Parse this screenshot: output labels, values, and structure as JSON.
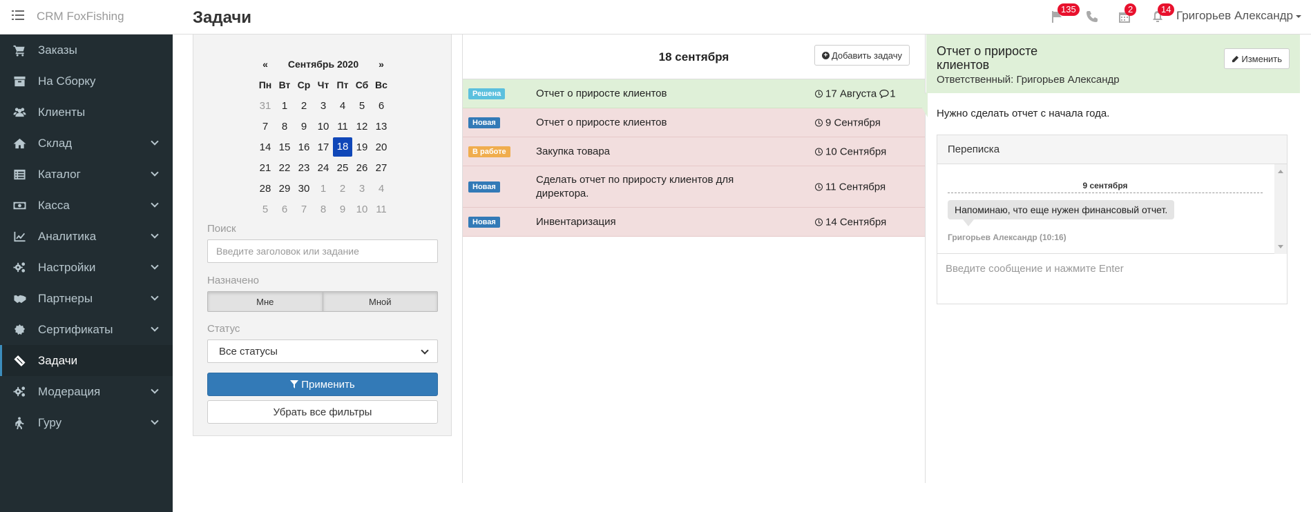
{
  "header": {
    "brand": "CRM FoxFishing",
    "page_title": "Задачи",
    "badges": {
      "flag": "135",
      "calendar": "2",
      "bell": "14"
    },
    "user_name": "Григорьев Александр"
  },
  "sidebar": {
    "items": [
      {
        "label": "Заказы",
        "icon": "cart-icon",
        "has_submenu": false
      },
      {
        "label": "На Сборку",
        "icon": "archive-icon",
        "has_submenu": false
      },
      {
        "label": "Клиенты",
        "icon": "users-icon",
        "has_submenu": false
      },
      {
        "label": "Склад",
        "icon": "home-icon",
        "has_submenu": true
      },
      {
        "label": "Каталог",
        "icon": "list-icon",
        "has_submenu": true
      },
      {
        "label": "Касса",
        "icon": "money-icon",
        "has_submenu": true
      },
      {
        "label": "Аналитика",
        "icon": "chart-icon",
        "has_submenu": true
      },
      {
        "label": "Настройки",
        "icon": "gears-icon",
        "has_submenu": true
      },
      {
        "label": "Партнеры",
        "icon": "handshake-icon",
        "has_submenu": true
      },
      {
        "label": "Сертификаты",
        "icon": "certificate-icon",
        "has_submenu": true
      },
      {
        "label": "Задачи",
        "icon": "ticket-icon",
        "has_submenu": false,
        "active": true
      },
      {
        "label": "Модерация",
        "icon": "gears-icon",
        "has_submenu": true
      },
      {
        "label": "Гуру",
        "icon": "walker-icon",
        "has_submenu": true
      }
    ]
  },
  "calendar": {
    "prev": "«",
    "next": "»",
    "month": "Сентябрь 2020",
    "weekdays": [
      "Пн",
      "Вт",
      "Ср",
      "Чт",
      "Пт",
      "Сб",
      "Вс"
    ],
    "weeks": [
      [
        "31",
        "1",
        "2",
        "3",
        "4",
        "5",
        "6"
      ],
      [
        "7",
        "8",
        "9",
        "10",
        "11",
        "12",
        "13"
      ],
      [
        "14",
        "15",
        "16",
        "17",
        "18",
        "19",
        "20"
      ],
      [
        "21",
        "22",
        "23",
        "24",
        "25",
        "26",
        "27"
      ],
      [
        "28",
        "29",
        "30",
        "1",
        "2",
        "3",
        "4"
      ],
      [
        "5",
        "6",
        "7",
        "8",
        "9",
        "10",
        "11"
      ]
    ],
    "selected": "18"
  },
  "filters": {
    "search_label": "Поиск",
    "search_placeholder": "Введите заголовок или задание",
    "assigned_label": "Назначено",
    "assigned_options": [
      "Мне",
      "Мной"
    ],
    "status_label": "Статус",
    "status_value": "Все статусы",
    "apply_label": "Применить",
    "clear_label": "Убрать все фильтры"
  },
  "tasks": {
    "date_header": "18 сентября",
    "add_label": "Добавить задачу",
    "rows": [
      {
        "status": "Решена",
        "status_color": "#5bc0de",
        "title": "Отчет о приросте клиентов",
        "date": "17 Августа",
        "comments": "1",
        "done": true
      },
      {
        "status": "Новая",
        "status_color": "#337ab7",
        "title": "Отчет о приросте клиентов",
        "date": "9 Сентября",
        "comments": "",
        "done": false
      },
      {
        "status": "В работе",
        "status_color": "#f0ad4e",
        "title": "Закупка товара",
        "date": "10 Сентября",
        "comments": "",
        "done": false
      },
      {
        "status": "Новая",
        "status_color": "#337ab7",
        "title": "Сделать отчет по приросту клиентов для директора.",
        "date": "11 Сентября",
        "comments": "",
        "done": false
      },
      {
        "status": "Новая",
        "status_color": "#337ab7",
        "title": "Инвентаризация",
        "date": "14 Сентября",
        "comments": "",
        "done": false
      }
    ]
  },
  "detail": {
    "title": "Отчет о приросте клиентов",
    "responsible": "Ответственный: Григорьев Александр",
    "edit_label": "Изменить",
    "description": "Нужно сделать отчет с начала года.",
    "chat": {
      "title": "Переписка",
      "date": "9 сентября",
      "message": "Напоминаю, что еще нужен финансовый отчет.",
      "author": "Григорьев Александр (10:16)",
      "input_placeholder": "Введите сообщение и нажмите Enter"
    }
  }
}
